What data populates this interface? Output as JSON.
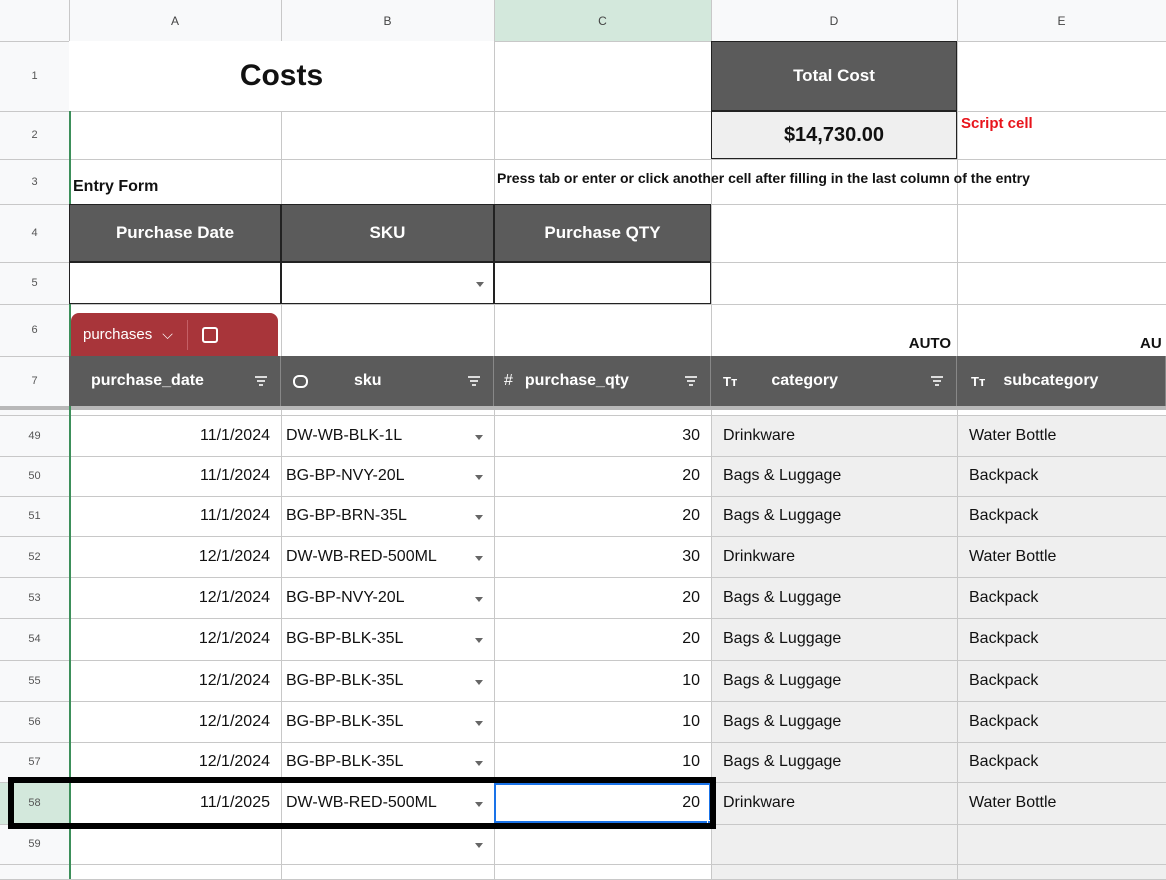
{
  "columns": [
    "A",
    "B",
    "C",
    "D",
    "E"
  ],
  "row_numbers": [
    "1",
    "2",
    "3",
    "4",
    "5",
    "6",
    "7",
    "49",
    "50",
    "51",
    "52",
    "53",
    "54",
    "55",
    "56",
    "57",
    "58",
    "59"
  ],
  "header": {
    "costs_title": "Costs",
    "total_cost_label": "Total Cost",
    "total_cost_value": "$14,730.00",
    "script_note": "Script cell"
  },
  "entry_form": {
    "title": "Entry Form",
    "instructions": "Press tab or enter or click another cell after filling in the last column of the entry",
    "headers": [
      "Purchase Date",
      "SKU",
      "Purchase QTY"
    ]
  },
  "table": {
    "name": "purchases",
    "auto_label": "AUTO",
    "auto_label_partial": "AU",
    "columns": [
      "purchase_date",
      "sku",
      "purchase_qty",
      "category",
      "subcategory"
    ],
    "type_icons": [
      "dropdown-chip",
      "#",
      "Tт",
      "Tт"
    ]
  },
  "rows": [
    {
      "row": "49",
      "date": "11/1/2024",
      "sku": "DW-WB-BLK-1L",
      "qty": "30",
      "category": "Drinkware",
      "subcategory": "Water Bottle"
    },
    {
      "row": "50",
      "date": "11/1/2024",
      "sku": "BG-BP-NVY-20L",
      "qty": "20",
      "category": "Bags & Luggage",
      "subcategory": "Backpack"
    },
    {
      "row": "51",
      "date": "11/1/2024",
      "sku": "BG-BP-BRN-35L",
      "qty": "20",
      "category": "Bags & Luggage",
      "subcategory": "Backpack"
    },
    {
      "row": "52",
      "date": "12/1/2024",
      "sku": "DW-WB-RED-500ML",
      "qty": "30",
      "category": "Drinkware",
      "subcategory": "Water Bottle"
    },
    {
      "row": "53",
      "date": "12/1/2024",
      "sku": "BG-BP-NVY-20L",
      "qty": "20",
      "category": "Bags & Luggage",
      "subcategory": "Backpack"
    },
    {
      "row": "54",
      "date": "12/1/2024",
      "sku": "BG-BP-BLK-35L",
      "qty": "20",
      "category": "Bags & Luggage",
      "subcategory": "Backpack"
    },
    {
      "row": "55",
      "date": "12/1/2024",
      "sku": "BG-BP-BLK-35L",
      "qty": "10",
      "category": "Bags & Luggage",
      "subcategory": "Backpack"
    },
    {
      "row": "56",
      "date": "12/1/2024",
      "sku": "BG-BP-BLK-35L",
      "qty": "10",
      "category": "Bags & Luggage",
      "subcategory": "Backpack"
    },
    {
      "row": "57",
      "date": "12/1/2024",
      "sku": "BG-BP-BLK-35L",
      "qty": "10",
      "category": "Bags & Luggage",
      "subcategory": "Backpack"
    },
    {
      "row": "58",
      "date": "11/1/2025",
      "sku": "DW-WB-RED-500ML",
      "qty": "20",
      "category": "Drinkware",
      "subcategory": "Water Bottle"
    },
    {
      "row": "59",
      "date": "",
      "sku": "",
      "qty": "",
      "category": "",
      "subcategory": ""
    }
  ],
  "colors": {
    "header_bg": "#5b5b5b",
    "table_tab": "#a8353a",
    "script_note": "#e8141b",
    "selection": "#1a73e8",
    "highlight_outline": "#000000",
    "auto_column_bg": "#efefef"
  }
}
